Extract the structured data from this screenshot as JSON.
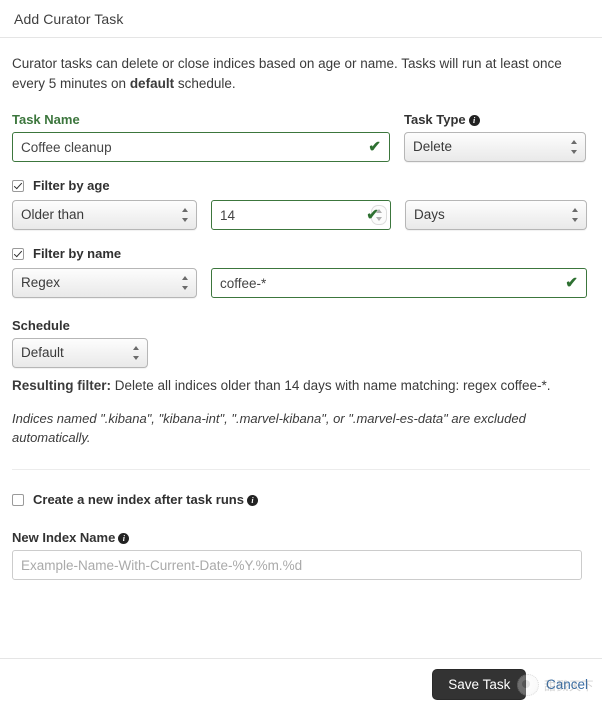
{
  "header": {
    "title": "Add Curator Task"
  },
  "intro": {
    "part1": "Curator tasks can delete or close indices based on age or name. Tasks will run at least once every 5 minutes on ",
    "strong": "default",
    "part2": " schedule."
  },
  "task_name": {
    "label": "Task Name",
    "value": "Coffee cleanup",
    "valid_icon": "check-icon"
  },
  "task_type": {
    "label": "Task Type",
    "info_icon": "info-icon",
    "value": "Delete"
  },
  "filter_age": {
    "checkbox_label": "Filter by age",
    "checked": true,
    "operator": "Older than",
    "amount": "14",
    "unit": "Days"
  },
  "filter_name": {
    "checkbox_label": "Filter by name",
    "checked": true,
    "match_type": "Regex",
    "pattern": "coffee-*"
  },
  "schedule": {
    "label": "Schedule",
    "value": "Default"
  },
  "resulting_filter": {
    "label": "Resulting filter:",
    "text": " Delete all indices older than 14 days with name matching: regex coffee-*."
  },
  "exclusion_note": {
    "text": "Indices named \".kibana\", \"kibana-int\", \".marvel-kibana\", or \".marvel-es-data\" are excluded automatically."
  },
  "new_index": {
    "checkbox_label": "Create a new index after task runs",
    "checked": false,
    "info_icon": "info-icon",
    "name_label": "New Index Name",
    "name_info_icon": "info-icon",
    "placeholder": "Example-Name-With-Current-Date-%Y.%m.%d",
    "value": ""
  },
  "footer": {
    "save_label": "Save Task",
    "cancel_label": "Cancel"
  },
  "watermark": {
    "text": "甜戮天下",
    "logo_icon": "circular-logo-icon"
  },
  "colors": {
    "valid_green": "#3c763d",
    "link_blue": "#3a6ea5",
    "button_dark": "#333333"
  }
}
